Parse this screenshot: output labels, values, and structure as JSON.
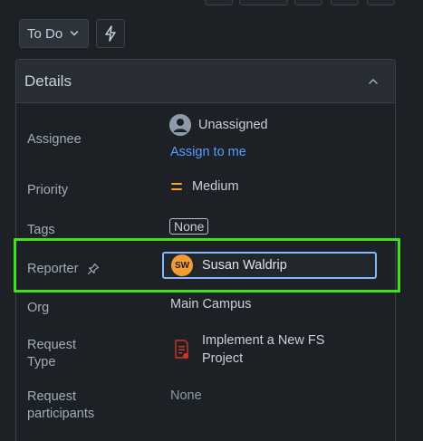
{
  "status": {
    "label": "To Do"
  },
  "panel": {
    "title": "Details"
  },
  "fields": {
    "assignee": {
      "label": "Assignee",
      "value": "Unassigned",
      "action": "Assign to me"
    },
    "priority": {
      "label": "Priority",
      "value": "Medium"
    },
    "tags": {
      "label": "Tags",
      "value": "None"
    },
    "reporter": {
      "label": "Reporter",
      "initials": "SW",
      "value": "Susan Waldrip"
    },
    "org": {
      "label": "Org",
      "value": "Main Campus"
    },
    "request_type": {
      "label_line1": "Request",
      "label_line2": "Type",
      "value_line1": "Implement a New FS",
      "value_line2": "Project"
    },
    "request_participants": {
      "label_line1": "Request",
      "label_line2": "participants",
      "value": "None"
    }
  },
  "colors": {
    "background": "#1d2125",
    "highlight": "#3de319",
    "focus": "#85b8ff",
    "link": "#579dff",
    "priority_medium": "#f5a623",
    "reporter_avatar": "#f39c35"
  },
  "icons": {
    "status_chevron": "chevron-down-icon",
    "automation": "lightning-bolt-icon",
    "collapse": "chevron-up-icon",
    "assignee_avatar": "user-avatar-icon",
    "priority": "priority-medium-icon",
    "pin": "pin-icon",
    "request_type": "request-type-icon"
  }
}
